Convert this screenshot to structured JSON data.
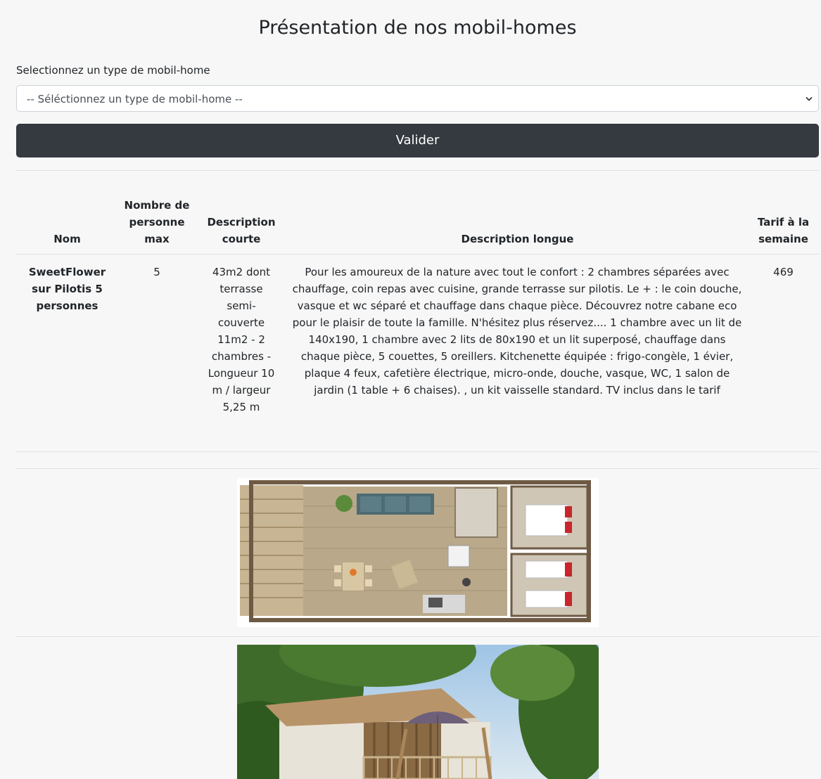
{
  "page": {
    "title": "Présentation de nos mobil-homes"
  },
  "form": {
    "select_label": "Selectionnez un type de mobil-home",
    "select_value": "-- Séléctionnez un type de mobil-home --",
    "submit_label": "Valider"
  },
  "table": {
    "headers": {
      "nom": "Nom",
      "personnes": "Nombre de personne max",
      "desc_courte": "Description courte",
      "desc_longue": "Description longue",
      "tarif": "Tarif à la semaine"
    },
    "rows": [
      {
        "nom": "SweetFlower sur Pilotis 5 personnes",
        "personnes": "5",
        "desc_courte": "43m2 dont terrasse semi-couverte 11m2 - 2 chambres - Longueur 10 m / largeur 5,25 m",
        "desc_longue": "Pour les amoureux de la nature avec tout le confort : 2 chambres séparées avec chauffage, coin repas avec cuisine, grande terrasse sur pilotis. Le + : le coin douche, vasque et wc séparé et chauffage dans chaque pièce. Découvrez notre cabane eco pour le plaisir de toute la famille. N'hésitez plus réservez.... 1 chambre avec un lit de 140x190, 1 chambre avec 2 lits de 80x190 et un lit superposé, chauffage dans chaque pièce, 5 couettes, 5 oreillers. Kitchenette équipée : frigo-congèle, 1 évier, plaque 4 feux, cafetière électrique, micro-onde, douche, vasque, WC, 1 salon de jardin (1 table + 6 chaises). , un kit vaisselle standard. TV inclus dans le tarif",
        "tarif": "469"
      }
    ]
  },
  "colors": {
    "button_bg": "#343a40",
    "border": "#dee2e6",
    "page_bg": "#f7f7f7"
  }
}
